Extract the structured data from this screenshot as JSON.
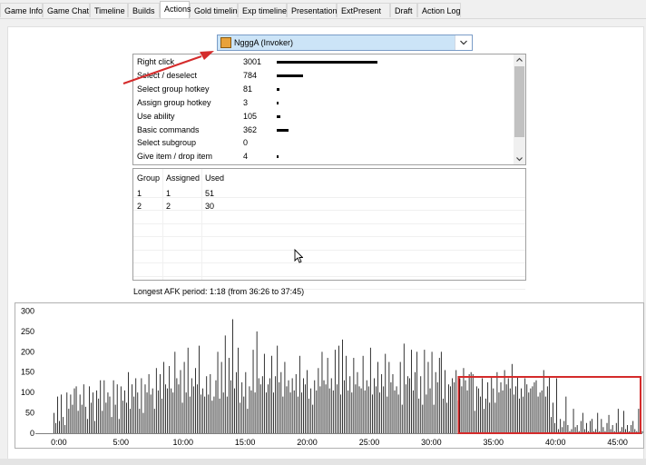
{
  "tabs": [
    {
      "label": "Game Info"
    },
    {
      "label": "Game Chat"
    },
    {
      "label": "Timeline"
    },
    {
      "label": "Builds"
    },
    {
      "label": "Actions",
      "active": true
    },
    {
      "label": "Gold timeline"
    },
    {
      "label": "Exp timeline"
    },
    {
      "label": "Presentation"
    },
    {
      "label": "ExtPresent"
    },
    {
      "label": "Draft"
    },
    {
      "label": "Action Log"
    }
  ],
  "player_select": {
    "value": "NgggA (Invoker)",
    "icon": "invoker-hero-icon",
    "selected_bg": "#cce4f7"
  },
  "actions": {
    "rows": [
      {
        "label": "Right click",
        "value": "3001",
        "count": 3001
      },
      {
        "label": "Select / deselect",
        "value": "784",
        "count": 784
      },
      {
        "label": "Select group hotkey",
        "value": "81",
        "count": 81
      },
      {
        "label": "Assign group hotkey",
        "value": "3",
        "count": 3
      },
      {
        "label": "Use ability",
        "value": "105",
        "count": 105
      },
      {
        "label": "Basic commands",
        "value": "362",
        "count": 362
      },
      {
        "label": "Select subgroup",
        "value": "0",
        "count": 0
      },
      {
        "label": "Give item / drop item",
        "value": "4",
        "count": 4
      }
    ]
  },
  "groups": {
    "headers": [
      "Group",
      "Assigned",
      "Used"
    ],
    "rows": [
      [
        "1",
        "1",
        "51"
      ],
      [
        "2",
        "2",
        "30"
      ]
    ]
  },
  "afk": {
    "text": "Longest AFK period: 1:18 (from 36:26 to 37:45)"
  },
  "annotations": {
    "arrow_color": "#d42b2b",
    "highlight_color": "#d42b2b"
  },
  "chart_data": {
    "type": "bar",
    "x_unit": "game time (minutes)",
    "xlim": [
      -1.6,
      47
    ],
    "ylim": [
      0,
      310
    ],
    "yticks": [
      "0",
      "50",
      "100",
      "150",
      "200",
      "250",
      "300"
    ],
    "ytick_values": [
      0,
      50,
      100,
      150,
      200,
      250,
      300
    ],
    "xticks": [
      "0:00",
      "5:00",
      "10:00",
      "15:00",
      "20:00",
      "25:00",
      "30:00",
      "35:00",
      "40:00",
      "45:00"
    ],
    "xtick_values": [
      0,
      5,
      10,
      15,
      20,
      25,
      30,
      35,
      40,
      45
    ],
    "bar_step_minutes": 0.15,
    "x_start": -0.4,
    "values": [
      50,
      25,
      90,
      30,
      95,
      40,
      20,
      100,
      60,
      95,
      70,
      110,
      115,
      55,
      95,
      70,
      120,
      65,
      35,
      115,
      75,
      100,
      30,
      105,
      85,
      130,
      55,
      130,
      75,
      100,
      90,
      40,
      130,
      70,
      120,
      35,
      115,
      80,
      105,
      75,
      150,
      60,
      120,
      90,
      135,
      100,
      60,
      135,
      50,
      120,
      100,
      145,
      95,
      110,
      60,
      160,
      105,
      145,
      85,
      175,
      120,
      110,
      165,
      110,
      100,
      200,
      135,
      120,
      155,
      75,
      175,
      100,
      210,
      90,
      135,
      115,
      160,
      120,
      215,
      95,
      110,
      90,
      140,
      95,
      145,
      80,
      90,
      130,
      200,
      85,
      175,
      100,
      240,
      90,
      185,
      130,
      280,
      110,
      150,
      210,
      75,
      125,
      90,
      150,
      60,
      115,
      105,
      205,
      100,
      250,
      135,
      120,
      140,
      195,
      100,
      120,
      135,
      190,
      100,
      140,
      215,
      125,
      150,
      90,
      175,
      115,
      130,
      100,
      135,
      105,
      145,
      90,
      190,
      100,
      135,
      120,
      155,
      85,
      110,
      70,
      130,
      105,
      160,
      115,
      200,
      130,
      120,
      185,
      110,
      135,
      105,
      205,
      120,
      215,
      95,
      230,
      130,
      190,
      105,
      140,
      100,
      185,
      120,
      150,
      115,
      110,
      190,
      105,
      130,
      115,
      210,
      95,
      135,
      115,
      175,
      100,
      145,
      115,
      195,
      90,
      175,
      125,
      145,
      105,
      115,
      95,
      175,
      70,
      220,
      120,
      140,
      135,
      205,
      105,
      150,
      200,
      85,
      140,
      70,
      205,
      95,
      175,
      110,
      200,
      70,
      150,
      125,
      185,
      200,
      85,
      155,
      75,
      120,
      115,
      135,
      125,
      155,
      80,
      135,
      115,
      160,
      130,
      105,
      145,
      150,
      145,
      55,
      115,
      110,
      90,
      135,
      60,
      85,
      125,
      75,
      140,
      110,
      75,
      150,
      100,
      125,
      105,
      155,
      120,
      135,
      110,
      170,
      95,
      115,
      140,
      85,
      110,
      90,
      135,
      120,
      100,
      110,
      115,
      125,
      130,
      90,
      100,
      105,
      155,
      90,
      115,
      140,
      40,
      75,
      25,
      135,
      10,
      35,
      15,
      30,
      90,
      20,
      5,
      10,
      60,
      15,
      20,
      5,
      30,
      50,
      10,
      25,
      5,
      30,
      35,
      5,
      10,
      50,
      5,
      35,
      15,
      5,
      25,
      45,
      10,
      20,
      5,
      25,
      60,
      5,
      15,
      55,
      10,
      20,
      5,
      20,
      30,
      10,
      5,
      60,
      15,
      5,
      30,
      10,
      70,
      5,
      30,
      5,
      60,
      15,
      25,
      75,
      10,
      40,
      80,
      20,
      10,
      30,
      45,
      15,
      35,
      5,
      50,
      20,
      15,
      90,
      25,
      35,
      45,
      60,
      65,
      30,
      100,
      25,
      15,
      45,
      55,
      15,
      65,
      25,
      20,
      70,
      25,
      55,
      20,
      25,
      5,
      15,
      75,
      10,
      20,
      30,
      10,
      50,
      20,
      55,
      30,
      10,
      15,
      60,
      20,
      35,
      75,
      10,
      20,
      80,
      5,
      45,
      20,
      65,
      15,
      25,
      10,
      40,
      20,
      55,
      10,
      75,
      15,
      30,
      10,
      80,
      5,
      60,
      20,
      30,
      10,
      95,
      15,
      35,
      70,
      20,
      50,
      100,
      25,
      10,
      5
    ]
  }
}
